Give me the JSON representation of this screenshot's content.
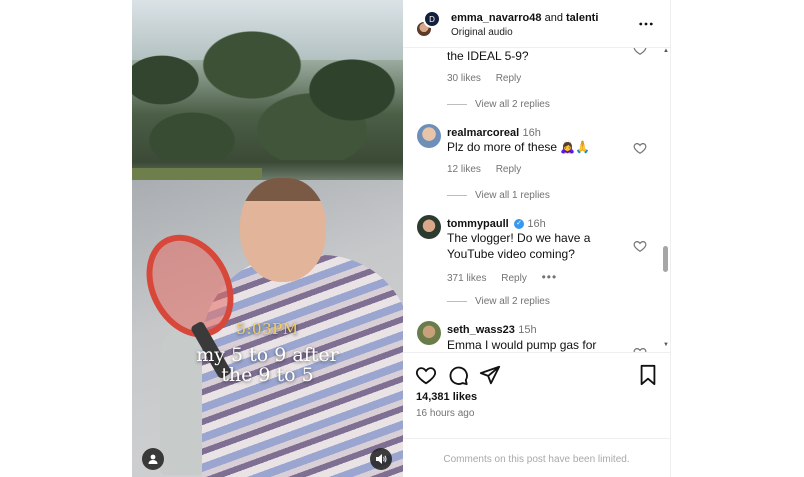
{
  "header": {
    "username": "emma_navarro48",
    "and_text": "and",
    "collaborator": "talenti",
    "audio": "Original audio",
    "avatar_letter": "D"
  },
  "video": {
    "caption_time": "5:03PM",
    "caption_line1": "my 5 to 9 after",
    "caption_line2": "the 9 to 5"
  },
  "comments": [
    {
      "text": "the IDEAL 5-9?",
      "likes": "30 likes",
      "reply": "Reply",
      "view_replies": "View all 2 replies"
    },
    {
      "user": "realmarcoreal",
      "time": "16h",
      "text": "Plz do more of these 🙇‍♀️🙏",
      "likes": "12 likes",
      "reply": "Reply",
      "view_replies": "View all 1 replies"
    },
    {
      "user": "tommypaull",
      "verified": true,
      "time": "16h",
      "text_line1": "The vlogger! Do we have a",
      "text_line2": "YouTube video coming?",
      "likes": "371 likes",
      "reply": "Reply",
      "more": "•••",
      "view_replies": "View all 2 replies"
    },
    {
      "user": "seth_wass23",
      "time": "15h",
      "text": "Emma I would pump gas for"
    }
  ],
  "footer": {
    "likes": "14,381 likes",
    "posted": "16 hours ago",
    "limited": "Comments on this post have been limited."
  },
  "colors": {
    "accent_verified": "#3897f0",
    "muted": "#737373",
    "caption_time": "#f5d05a"
  }
}
